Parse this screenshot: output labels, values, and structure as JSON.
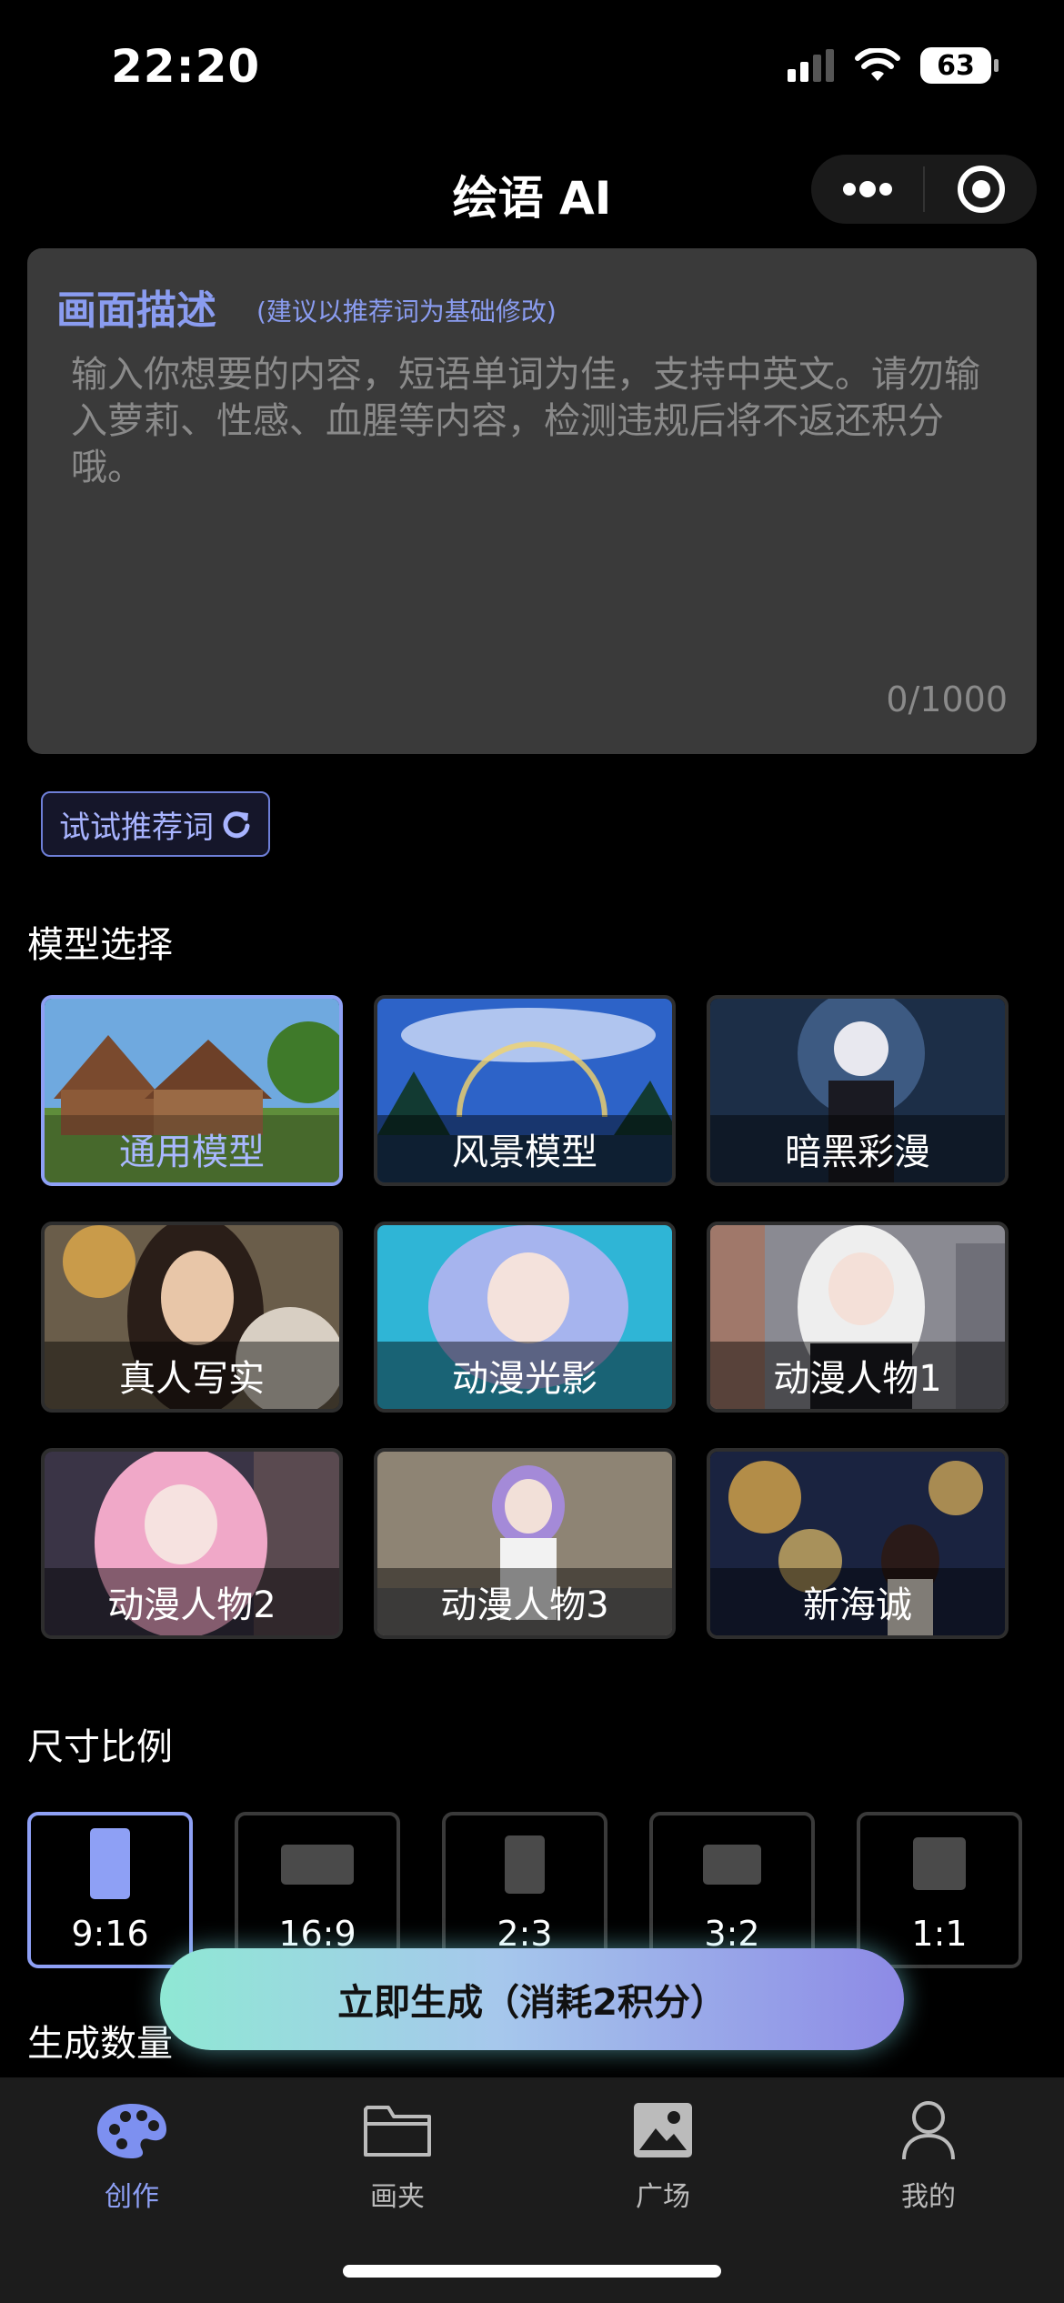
{
  "status": {
    "time": "22:20",
    "battery": "63"
  },
  "nav": {
    "title": "绘语 AI"
  },
  "prompt": {
    "title": "画面描述",
    "hint": "(建议以推荐词为基础修改)",
    "placeholder": "输入你想要的内容，短语单词为佳，支持中英文。请勿输入萝莉、性感、血腥等内容，检测违规后将不返还积分哦。",
    "counter": "0/1000"
  },
  "suggest_label": "试试推荐词",
  "model_section": {
    "label": "模型选择",
    "models": [
      {
        "label": "通用模型",
        "selected": true
      },
      {
        "label": "风景模型",
        "selected": false
      },
      {
        "label": "暗黑彩漫",
        "selected": false
      },
      {
        "label": "真人写实",
        "selected": false
      },
      {
        "label": "动漫光影",
        "selected": false
      },
      {
        "label": "动漫人物1",
        "selected": false
      },
      {
        "label": "动漫人物2",
        "selected": false
      },
      {
        "label": "动漫人物3",
        "selected": false
      },
      {
        "label": "新海诚",
        "selected": false
      }
    ]
  },
  "ratio_section": {
    "label": "尺寸比例",
    "ratios": [
      {
        "label": "9:16",
        "selected": true
      },
      {
        "label": "16:9",
        "selected": false
      },
      {
        "label": "2:3",
        "selected": false
      },
      {
        "label": "3:2",
        "selected": false
      },
      {
        "label": "1:1",
        "selected": false
      }
    ]
  },
  "count_section": {
    "label": "生成数量"
  },
  "generate_label": "立即生成（消耗2积分）",
  "tabs": [
    {
      "label": "创作",
      "icon": "palette-icon",
      "active": true
    },
    {
      "label": "画夹",
      "icon": "folder-icon",
      "active": false
    },
    {
      "label": "广场",
      "icon": "image-icon",
      "active": false
    },
    {
      "label": "我的",
      "icon": "person-icon",
      "active": false
    }
  ],
  "colors": {
    "accent": "#8ea0f5",
    "background": "#000000",
    "panel": "#3a3a3a",
    "tabbar": "#1c1c1c"
  }
}
